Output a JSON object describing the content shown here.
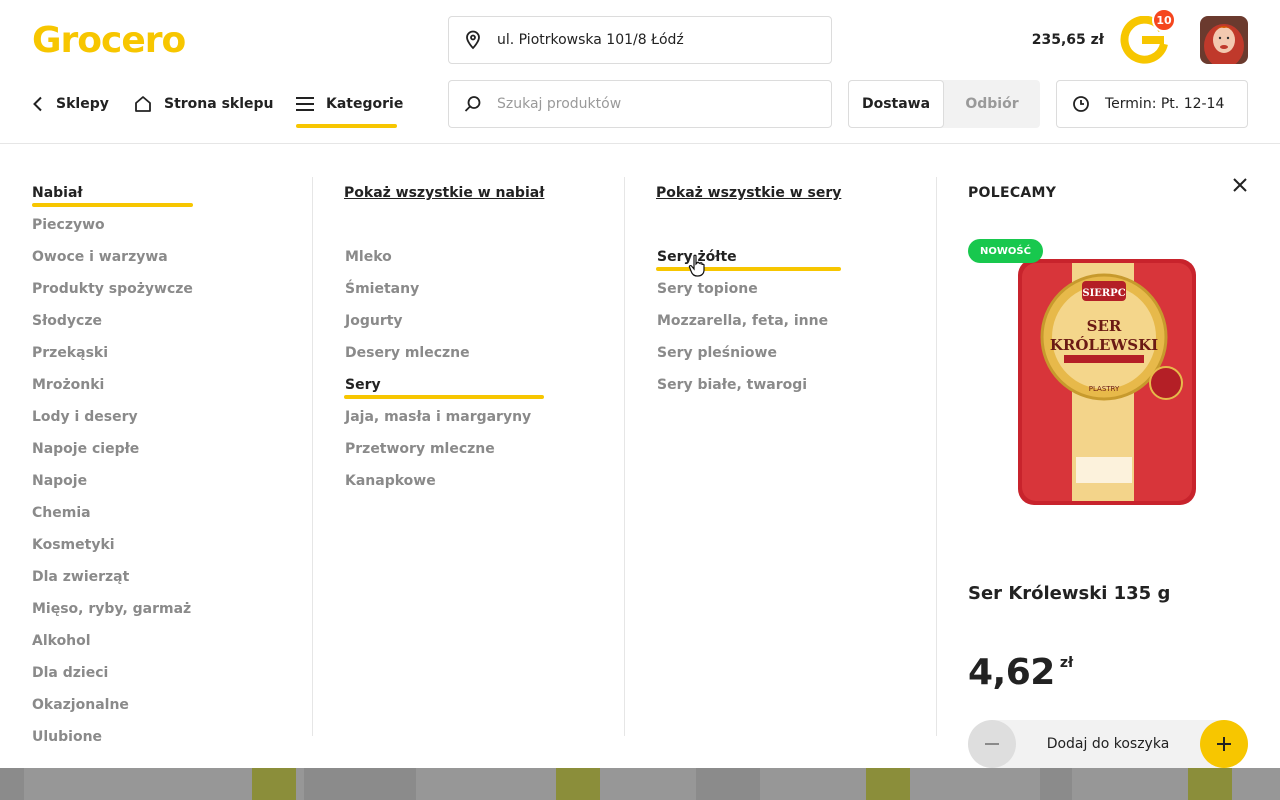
{
  "brand": {
    "logo_text": "Grocero",
    "accent": "#F7C600"
  },
  "header": {
    "address": "ul. Piotrkowska 101/8 Łódź",
    "cart_total": "235,65 zł",
    "cart_count": "10",
    "search_placeholder": "Szukaj produktów",
    "delivery_options": [
      "Dostawa",
      "Odbiór"
    ],
    "term": "Termin: Pt. 12-14"
  },
  "nav": {
    "back_label": "Sklepy",
    "store_label": "Strona sklepu",
    "categories_label": "Kategorie"
  },
  "menu": {
    "categories": [
      "Nabiał",
      "Pieczywo",
      "Owoce i warzywa",
      "Produkty spożywcze",
      "Słodycze",
      "Przekąski",
      "Mrożonki",
      "Lody i desery",
      "Napoje ciepłe",
      "Napoje",
      "Chemia",
      "Kosmetyki",
      "Dla zwierząt",
      "Mięso, ryby, garmaż",
      "Alkohol",
      "Dla dzieci",
      "Okazjonalne",
      "Ulubione"
    ],
    "subcategories_show_all": "Pokaż wszystkie w nabiał",
    "subcategories": [
      "Mleko",
      "Śmietany",
      "Jogurty",
      "Desery mleczne",
      "Sery",
      "Jaja, masła i margaryny",
      "Przetwory mleczne",
      "Kanapkowe"
    ],
    "subsub_show_all": "Pokaż wszystkie w sery",
    "subsubcategories": [
      "Sery żółte",
      "Sery topione",
      "Mozzarella, feta, inne",
      "Sery pleśniowe",
      "Sery białe, twarogi"
    ]
  },
  "promo": {
    "title": "POLECAMY",
    "badge": "NOWOŚĆ",
    "product_name": "Ser Królewski 135 g",
    "price_main": "4,62",
    "price_currency": "zł",
    "add_label": "Dodaj do koszyka",
    "package_brand": "SIERPC",
    "package_line1": "SER",
    "package_line2": "KRÓLEWSKI",
    "package_variant": "PLASTRY"
  },
  "icons": {
    "location": "location-pin-icon",
    "search": "search-icon",
    "back": "chevron-left-icon",
    "home": "home-icon",
    "menu": "hamburger-menu-icon",
    "clock": "clock-icon",
    "close": "close-icon",
    "minus": "minus-icon",
    "plus": "plus-icon"
  }
}
